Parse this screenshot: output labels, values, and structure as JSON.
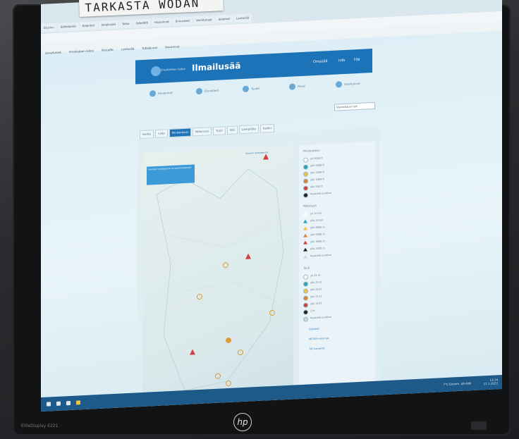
{
  "label_text": "TARKASTA WODAN",
  "monitor_model": "EliteDisplay E221",
  "brand_logo": "hp",
  "browser": {
    "tabs": [
      "Etusivu",
      "Sähköposti",
      "Kalenteri",
      "Ilmailusää",
      "Tutka",
      "Satelliitti",
      "Havainnot",
      "Ennusteet",
      "Varoitukset",
      "Salamat",
      "Lentosää"
    ],
    "bookmarks": [
      "Sovellukset",
      "Ilmatieteen laitos",
      "Fintraffic",
      "Lentosää",
      "Tutkakuvat",
      "Havainnot"
    ]
  },
  "site": {
    "brand_prefix": "Ilmatieteen laitos",
    "brand": "Ilmailusää",
    "header_links": [
      "Omasää",
      "Info",
      "FIN"
    ],
    "nav": [
      "Havainnot",
      "Ennusteet",
      "Tuulet",
      "Pilvet",
      "Varoitukset"
    ],
    "select_value": "Vuorokausi nyt",
    "subtabs": [
      "Kartta",
      "Lista",
      "Pilvikorkeus",
      "Näkyvyys",
      "Tuuli",
      "Sää",
      "Lämpötila",
      "Kaikki"
    ]
  },
  "map": {
    "info_text": "Suomen lentoasemat ja havaintoasemat",
    "link": "Suomen lentoasemat",
    "markers": [
      {
        "x": 0.82,
        "y": 0.04,
        "kind": "tri"
      },
      {
        "x": 0.55,
        "y": 0.46,
        "kind": "circle"
      },
      {
        "x": 0.7,
        "y": 0.43,
        "kind": "tri"
      },
      {
        "x": 0.38,
        "y": 0.58,
        "kind": "circle"
      },
      {
        "x": 0.86,
        "y": 0.66,
        "kind": "circle"
      },
      {
        "x": 0.57,
        "y": 0.76,
        "kind": "dot"
      },
      {
        "x": 0.65,
        "y": 0.81,
        "kind": "circle"
      },
      {
        "x": 0.33,
        "y": 0.8,
        "kind": "tri"
      },
      {
        "x": 0.5,
        "y": 0.9,
        "kind": "circle"
      },
      {
        "x": 0.57,
        "y": 0.93,
        "kind": "circle"
      }
    ]
  },
  "legend": {
    "sections": [
      {
        "title": "Pilvikorkeus",
        "items": [
          "yli 5000 ft",
          "alle 5000 ft",
          "alle 1500 ft",
          "alle 1000 ft",
          "alle 500 ft",
          "havainto puuttuu"
        ]
      },
      {
        "title": "Näkyvyys",
        "items": [
          "yli 10 km",
          "alle 10 km",
          "alle 8000 m",
          "alle 5000 m",
          "alle 3000 m",
          "alle 1500 m",
          "havainto puuttuu"
        ]
      },
      {
        "title": "Tuuli",
        "items": [
          "yli 25 kt",
          "alle 25 kt",
          "alle 20 kt",
          "alle 15 kt",
          "alle 10 kt",
          "2 kt",
          "havainto puuttuu"
        ]
      }
    ],
    "links": [
      "Selitteet",
      "METAR-sanomat",
      "TAF-sanomat"
    ]
  },
  "taskbar": {
    "weather": "7°C Enimm. pilvistä",
    "time": "13:14",
    "date": "17.1.2023"
  },
  "colors": {
    "brand_blue": "#1d73b8",
    "marker_red": "#d33f3f",
    "marker_orange": "#e09a3a"
  }
}
